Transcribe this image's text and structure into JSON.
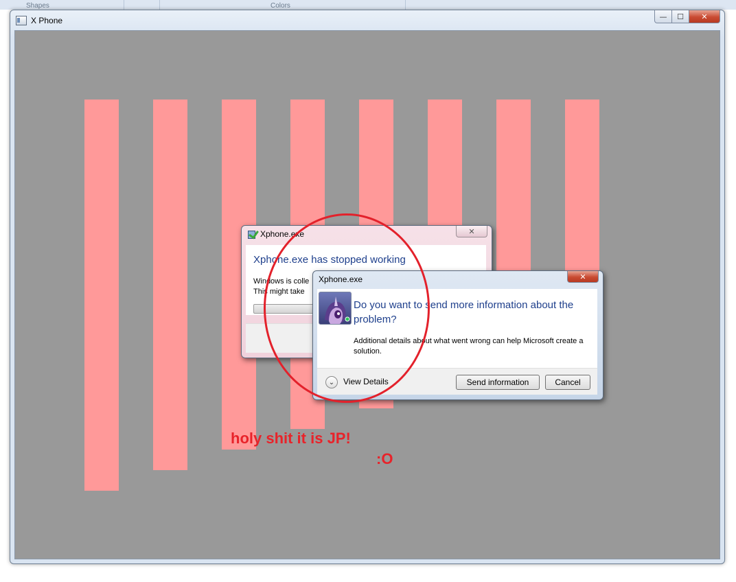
{
  "background": {
    "labels": [
      "Shapes",
      "Colors"
    ]
  },
  "window": {
    "title": "X Phone",
    "caption": {
      "minimize": "—",
      "maximize": "☐",
      "close": "✕"
    }
  },
  "annotations": {
    "caption": "holy shit it is JP!",
    "face": ":O"
  },
  "dialog_stopped": {
    "title": "Xphone.exe",
    "heading": "Xphone.exe has stopped working",
    "line1": "Windows is colle",
    "line2": "This might take",
    "close": "✕"
  },
  "dialog_send": {
    "title": "Xphone.exe",
    "close": "✕",
    "heading": "Do you want to send more information about the problem?",
    "body": "Additional details about what went wrong can help Microsoft create a solution.",
    "view_details": "View Details",
    "view_details_icon": "chevron-down-icon",
    "send_label": "Send information",
    "cancel_label": "Cancel"
  },
  "colors": {
    "client_bg": "#999999",
    "bars": "#ff9999",
    "annotation": "#e3212b",
    "heading": "#1e3f8c"
  }
}
